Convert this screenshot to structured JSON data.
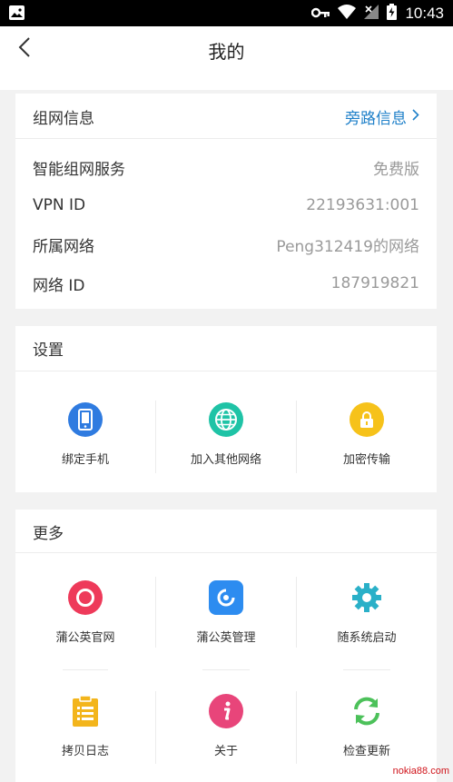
{
  "status_bar": {
    "time": "10:43",
    "icons": [
      "image-icon",
      "key-icon",
      "wifi-icon",
      "signal-icon",
      "battery-charging-icon"
    ]
  },
  "header": {
    "title": "我的",
    "back_icon": "chevron-left-icon"
  },
  "network_info": {
    "title": "组网信息",
    "link_label": "旁路信息",
    "rows": [
      {
        "label": "智能组网服务",
        "value": "免费版"
      },
      {
        "label": "VPN ID",
        "value": "22193631:001"
      },
      {
        "label": "所属网络",
        "value": "Peng312419的网络"
      },
      {
        "label": "网络 ID",
        "value": "187919821"
      }
    ]
  },
  "settings": {
    "title": "设置",
    "items": [
      {
        "label": "绑定手机",
        "icon": "phone-icon",
        "color": "#2f7be0"
      },
      {
        "label": "加入其他网络",
        "icon": "globe-icon",
        "color": "#1fc3a6"
      },
      {
        "label": "加密传输",
        "icon": "lock-icon",
        "color": "#f6c21a"
      }
    ]
  },
  "more": {
    "title": "更多",
    "items": [
      {
        "label": "蒲公英官网",
        "icon": "ring-icon",
        "color": "#ee3a5a"
      },
      {
        "label": "蒲公英管理",
        "icon": "dandelion-app-icon",
        "color": "#2d8cf0"
      },
      {
        "label": "随系统启动",
        "icon": "gear-icon",
        "color": "#2ab0c8"
      },
      {
        "label": "拷贝日志",
        "icon": "clipboard-icon",
        "color": "#f3b51c"
      },
      {
        "label": "关于",
        "icon": "info-icon",
        "color": "#e8457a"
      },
      {
        "label": "检查更新",
        "icon": "refresh-icon",
        "color": "#4cc15a"
      }
    ]
  },
  "watermark": "nokia88.com"
}
